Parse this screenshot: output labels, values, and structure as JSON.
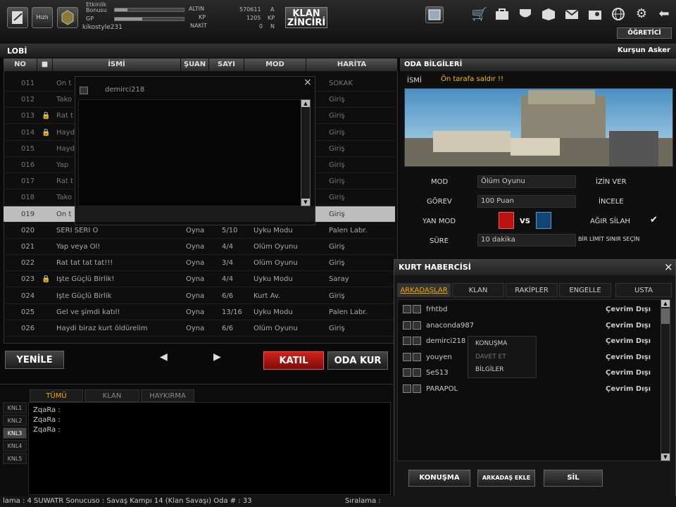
{
  "header": {
    "user_label_line1": "Etkinlik",
    "user_label_line2": "Bonusu",
    "gp_label": "GP",
    "username": "kikostyle231",
    "altin_label": "ALTIN",
    "kp_label": "KP",
    "nakit_label": "NAKİT",
    "altin_value": "570611",
    "kp_value": "1205",
    "nakit_value": "0",
    "altin_unit": "A",
    "kp_unit": "KP",
    "nakit_unit": "N",
    "klan_button": "KLAN ZİNCİRİ",
    "ogretici_label": "ÖĞRETİCİ",
    "level_badge": "Hızlı"
  },
  "lobi": {
    "title": "LOBİ",
    "rank": "Kurşun Asker",
    "columns": [
      "NO",
      "■",
      "İSMİ",
      "ŞUAN",
      "SAYI",
      "MOD",
      "HARİTA"
    ],
    "rows": [
      {
        "no": "011",
        "lock": "",
        "name": "On t",
        "state": "",
        "count": "",
        "mode": "",
        "map": "SOKAK"
      },
      {
        "no": "012",
        "lock": "",
        "name": "Tako",
        "state": "",
        "count": "",
        "mode": "",
        "map": "Giriş"
      },
      {
        "no": "013",
        "lock": "🔒",
        "name": "Rat t",
        "state": "",
        "count": "",
        "mode": "",
        "map": "Giriş"
      },
      {
        "no": "014",
        "lock": "🔒",
        "name": "Hayd",
        "state": "",
        "count": "",
        "mode": "",
        "map": "Giriş"
      },
      {
        "no": "015",
        "lock": "",
        "name": "Hayd",
        "state": "",
        "count": "",
        "mode": "",
        "map": "Giriş"
      },
      {
        "no": "016",
        "lock": "",
        "name": "Yap",
        "state": "",
        "count": "",
        "mode": "",
        "map": "Giriş"
      },
      {
        "no": "017",
        "lock": "",
        "name": "Rat t",
        "state": "",
        "count": "",
        "mode": "",
        "map": "Giriş"
      },
      {
        "no": "018",
        "lock": "",
        "name": "Tako",
        "state": "",
        "count": "",
        "mode": "",
        "map": "Giriş"
      },
      {
        "no": "019",
        "lock": "",
        "name": "On t",
        "state": "",
        "count": "",
        "mode": "",
        "map": "Giriş"
      },
      {
        "no": "020",
        "lock": "",
        "name": "SERİ SERİ O",
        "state": "Oyna",
        "count": "5/10",
        "mode": "Uyku Modu",
        "map": "Palen Labr."
      },
      {
        "no": "021",
        "lock": "",
        "name": "Yap veya Ol!",
        "state": "Oyna",
        "count": "4/4",
        "mode": "Ölüm Oyunu",
        "map": "Giriş"
      },
      {
        "no": "022",
        "lock": "",
        "name": "Rat tat tat tat!!!",
        "state": "Oyna",
        "count": "3/4",
        "mode": "Ölüm Oyunu",
        "map": "Giriş"
      },
      {
        "no": "023",
        "lock": "🔒",
        "name": "İşte Güçlü Birlik!",
        "state": "Oyna",
        "count": "4/4",
        "mode": "Uyku Modu",
        "map": "Saray"
      },
      {
        "no": "024",
        "lock": "",
        "name": "İşte Güçlü Birlik",
        "state": "Oyna",
        "count": "6/6",
        "mode": "Kurt Av.",
        "map": "Giriş"
      },
      {
        "no": "025",
        "lock": "",
        "name": "Gel ve şimdi katıl!",
        "state": "Oyna",
        "count": "13/16",
        "mode": "Uyku Modu",
        "map": "Palen Labr."
      },
      {
        "no": "026",
        "lock": "",
        "name": "Haydi biraz kurt öldürelim",
        "state": "Oyna",
        "count": "6/6",
        "mode": "Ölüm Oyunu",
        "map": "Giriş"
      }
    ],
    "yenile": "YENİLE",
    "katil": "KATIL",
    "oda_kur": "ODA KUR",
    "overlay_user": "demirci218",
    "overlay_close": "×"
  },
  "oda": {
    "title": "ODA BİLGİLERİ",
    "isim_label": "İSMİ",
    "isim_value": "Ön tarafa saldır !!",
    "mod_label": "MOD",
    "mod_value": "Ölüm Oyunu",
    "gorev_label": "GÖREV",
    "gorev_value": "100 Puan",
    "yan_mod_label": "YAN MOD",
    "vs_label": "VS",
    "sure_label": "SÜRE",
    "sure_value": "10 dakika",
    "izin_ver": "İZİN VER",
    "incele": "İNCELE",
    "agir_silah": "AĞIR SİLAH",
    "check_mark": "✔",
    "bir_limit": "BİR LİMİT SINIR SEÇİN"
  },
  "kurt": {
    "title": "KURT HABERCİSİ",
    "close": "×",
    "tabs": [
      "ARKADAŞLAR",
      "KLAN",
      "RAKİPLER",
      "ENGELLE",
      "USTA"
    ],
    "friends": [
      {
        "name": "frhtbd",
        "status": "Çevrim Dışı"
      },
      {
        "name": "anaconda987",
        "status": "Çevrim Dışı"
      },
      {
        "name": "demirci218",
        "status": "Çevrim Dışı"
      },
      {
        "name": "youyen",
        "status": "Çevrim Dışı"
      },
      {
        "name": "SeS13",
        "status": "Çevrim Dışı"
      },
      {
        "name": "PARAPOL",
        "status": "Çevrim Dışı"
      }
    ],
    "context_menu": [
      "KONUŞMA",
      "DAVET ET",
      "BİLGİLER"
    ],
    "konusma_btn": "KONUŞMA",
    "arkadas_ekle_btn": "ARKADAŞ EKLE",
    "sil_btn": "SİL"
  },
  "chat": {
    "tabs": [
      "TÜMÜ",
      "KLAN",
      "HAYKIRMA"
    ],
    "channels": [
      "KNL1",
      "KNL2",
      "KNL3",
      "KNL4",
      "KNL5"
    ],
    "messages": [
      "ZqaRa :",
      "ZqaRa :",
      "ZqaRa :"
    ]
  },
  "ticker": "lama : 4 SUWATR Sonucuso : Savaş Kampı 14 (Klan Savaşı) Oda # : 33",
  "ticker_right": "Sıralama :"
}
